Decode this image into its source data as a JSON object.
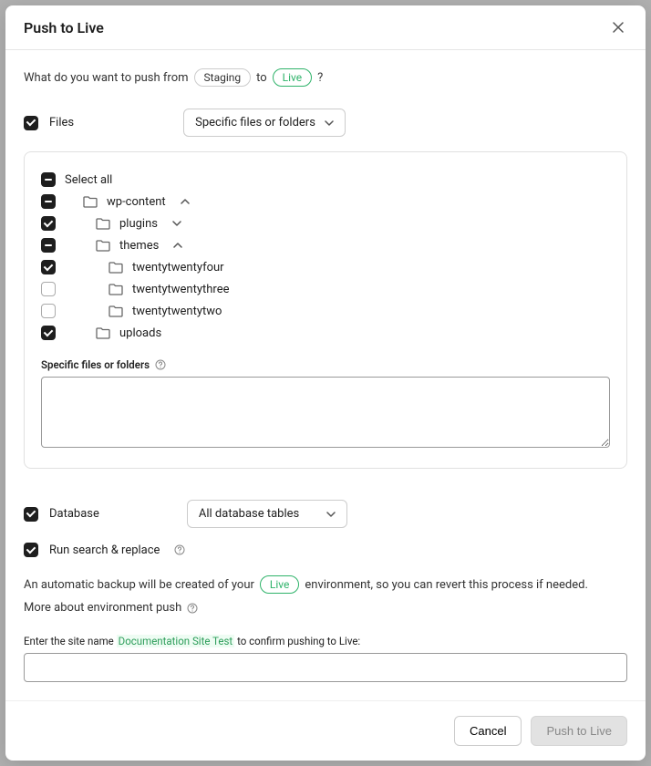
{
  "header": {
    "title": "Push to Live"
  },
  "question": {
    "prefix": "What do you want to push from",
    "from_env": "Staging",
    "middle": "to",
    "to_env": "Live",
    "suffix": "?"
  },
  "files": {
    "label": "Files",
    "select_label": "Specific files or folders",
    "tree": {
      "select_all": "Select all",
      "wp_content": "wp-content",
      "plugins": "plugins",
      "themes": "themes",
      "twentyfour": "twentytwentyfour",
      "twentythree": "twentytwentythree",
      "twentytwo": "twentytwentytwo",
      "uploads": "uploads"
    },
    "specific_label": "Specific files or folders"
  },
  "database": {
    "label": "Database",
    "select_label": "All database tables"
  },
  "search_replace": {
    "label": "Run search & replace"
  },
  "backup_info": {
    "prefix": "An automatic backup will be created of your",
    "env": "Live",
    "suffix": "environment, so you can revert this process if needed."
  },
  "more_link": "More about environment push",
  "confirm": {
    "prefix": "Enter the site name",
    "site_name": "Documentation Site Test",
    "suffix": "to confirm pushing to Live:"
  },
  "footer": {
    "cancel": "Cancel",
    "push": "Push to Live"
  }
}
